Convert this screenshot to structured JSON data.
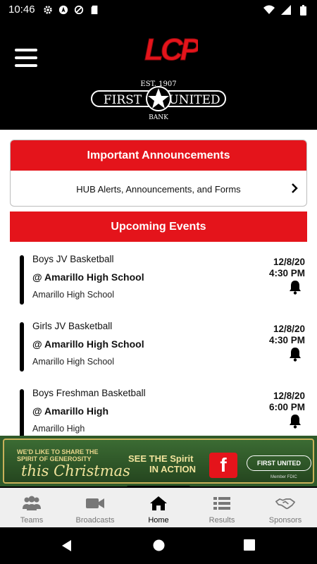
{
  "status_bar": {
    "time": "10:46",
    "icons_left": [
      "gear-icon",
      "nav-arrow-icon",
      "do-not-disturb-icon",
      "sd-card-icon"
    ],
    "icons_right": [
      "wifi-icon",
      "signal-icon",
      "battery-icon"
    ]
  },
  "header": {
    "logo_text": "LCP",
    "sponsor_logo": {
      "top_text": "EST. 1907",
      "main_left": "FIRST",
      "main_right": "UNITED",
      "bottom_text": "BANK"
    }
  },
  "announcements": {
    "title": "Important Announcements",
    "link_label": "HUB Alerts, Announcements, and Forms"
  },
  "events": {
    "title": "Upcoming Events",
    "items": [
      {
        "name": "Boys JV Basketball",
        "opponent": "@ Amarillo High School",
        "location": "Amarillo High School",
        "date": "12/8/20",
        "time": "4:30 PM"
      },
      {
        "name": "Girls JV Basketball",
        "opponent": "@ Amarillo High School",
        "location": "Amarillo High School",
        "date": "12/8/20",
        "time": "4:30 PM"
      },
      {
        "name": "Boys Freshman Basketball",
        "opponent": "@ Amarillo High",
        "location": "Amarillo High",
        "date": "12/8/20",
        "time": "6:00 PM"
      }
    ]
  },
  "banner": {
    "line1": "WE'D LIKE TO SHARE THE",
    "line2": "SPIRIT OF GENEROSITY",
    "script": "this Christmas",
    "cta_line1": "SEE THE Spirit",
    "cta_line2": "IN ACTION",
    "bank": "FIRST UNITED",
    "fdic": "Member FDIC"
  },
  "bottom_nav": {
    "items": [
      {
        "label": "Teams",
        "icon": "people-icon",
        "active": false
      },
      {
        "label": "Broadcasts",
        "icon": "video-camera-icon",
        "active": false
      },
      {
        "label": "Home",
        "icon": "home-icon",
        "active": true
      },
      {
        "label": "Results",
        "icon": "list-icon",
        "active": false
      },
      {
        "label": "Sponsors",
        "icon": "handshake-icon",
        "active": false
      }
    ]
  },
  "colors": {
    "accent_red": "#e4141b",
    "header_bg": "#000000",
    "nav_bg": "#efefef"
  }
}
